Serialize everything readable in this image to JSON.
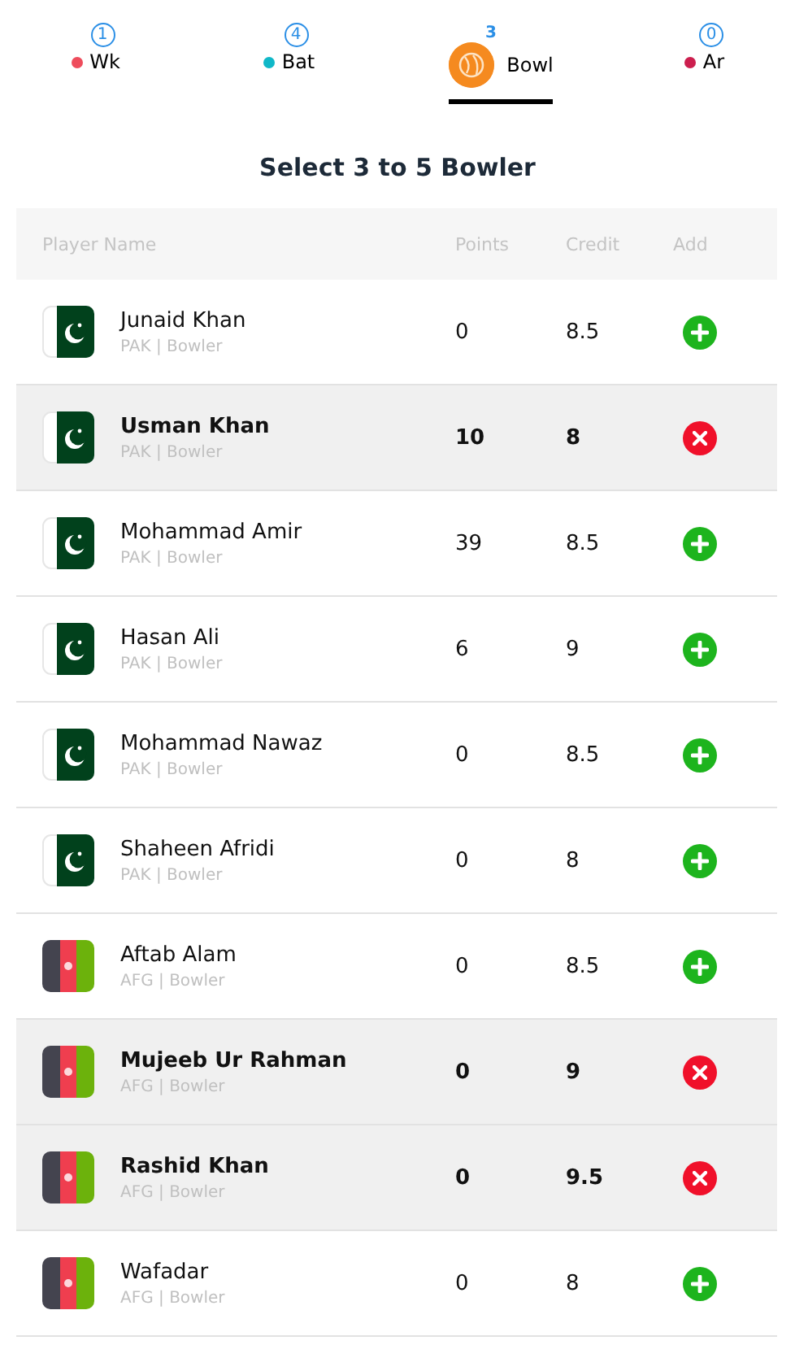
{
  "tabs": [
    {
      "count": "1",
      "label": "Wk",
      "color": "#ee4c5c",
      "selected": false
    },
    {
      "count": "4",
      "label": "Bat",
      "color": "#10b8c8",
      "selected": false
    },
    {
      "count": "3",
      "label": "Bowl",
      "color": "#f58a1f",
      "selected": true
    },
    {
      "count": "0",
      "label": "Ar",
      "color": "#cc1f4e",
      "selected": false
    }
  ],
  "heading": "Select 3 to 5 Bowler",
  "table": {
    "columns": [
      "Player Name",
      "Points",
      "Credit",
      "Add"
    ],
    "rows": [
      {
        "kind": "pak",
        "name": "Junaid Khan",
        "info": "PAK | Bowler",
        "points": "0",
        "credit": "8.5",
        "selected": false
      },
      {
        "kind": "pak",
        "name": "Usman Khan",
        "info": "PAK | Bowler",
        "points": "10",
        "credit": "8",
        "selected": true
      },
      {
        "kind": "pak",
        "name": "Mohammad Amir",
        "info": "PAK | Bowler",
        "points": "39",
        "credit": "8.5",
        "selected": false
      },
      {
        "kind": "pak",
        "name": "Hasan Ali",
        "info": "PAK | Bowler",
        "points": "6",
        "credit": "9",
        "selected": false
      },
      {
        "kind": "pak",
        "name": "Mohammad Nawaz",
        "info": "PAK | Bowler",
        "points": "0",
        "credit": "8.5",
        "selected": false
      },
      {
        "kind": "pak",
        "name": "Shaheen Afridi",
        "info": "PAK | Bowler",
        "points": "0",
        "credit": "8",
        "selected": false
      },
      {
        "kind": "afg",
        "name": "Aftab Alam",
        "info": "AFG | Bowler",
        "points": "0",
        "credit": "8.5",
        "selected": false
      },
      {
        "kind": "afg",
        "name": "Mujeeb Ur Rahman",
        "info": "AFG | Bowler",
        "points": "0",
        "credit": "9",
        "selected": true
      },
      {
        "kind": "afg",
        "name": "Rashid Khan",
        "info": "AFG | Bowler",
        "points": "0",
        "credit": "9.5",
        "selected": true
      },
      {
        "kind": "afg",
        "name": "Wafadar",
        "info": "AFG | Bowler",
        "points": "0",
        "credit": "8",
        "selected": false
      }
    ]
  }
}
